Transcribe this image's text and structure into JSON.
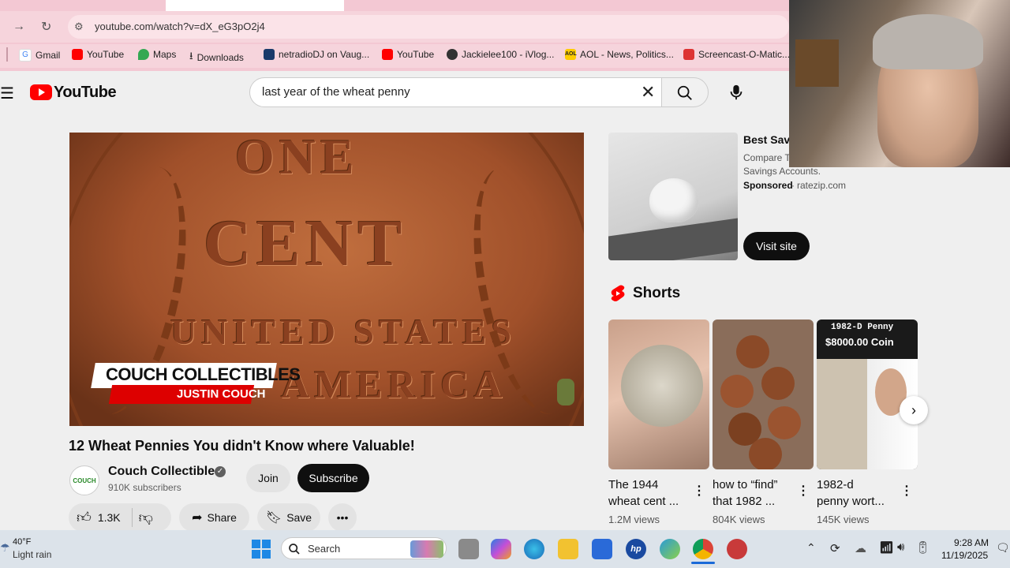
{
  "browser": {
    "url": "youtube.com/watch?v=dX_eG3pO2j4",
    "bookmarks": [
      "Gmail",
      "YouTube",
      "Maps",
      "Downloads",
      "netradioDJ on Vaug...",
      "YouTube",
      "Jackielee100 - iVlog...",
      "AOL - News, Politics...",
      "Screencast-O-Matic..."
    ]
  },
  "youtube": {
    "logo_text": "YouTube",
    "search_query": "last year of the wheat penny",
    "video": {
      "overlay_channel": "COUCH COLLECTIBLES",
      "overlay_name": "JUSTIN COUCH",
      "coin_words": [
        "ONE",
        "CENT",
        "UNITED STATES",
        "AMERICA"
      ],
      "title": "12 Wheat Pennies You didn't Know where Valuable!",
      "channel_name": "Couch Collectibles",
      "avatar_text": "COUCH",
      "subscribers": "910K subscribers",
      "join_label": "Join",
      "subscribe_label": "Subscribe",
      "likes": "1.3K",
      "share_label": "Share",
      "save_label": "Save"
    },
    "ad": {
      "title": "Best Savi",
      "desc_line1": "Compare T",
      "desc_line2": "Savings Accounts.",
      "sponsored": "Sponsored",
      "domain": "ratezip.com",
      "visit_label": "Visit site"
    },
    "shorts_heading": "Shorts",
    "shorts": [
      {
        "title_line1": "The 1944",
        "title_line2": "wheat cent ...",
        "views": "1.2M views"
      },
      {
        "title_line1": "how to “find”",
        "title_line2": "that 1982 ...",
        "views": "804K views"
      },
      {
        "title_line1": "1982-d",
        "title_line2": "penny wort...",
        "views": "145K views",
        "thumb_top": "1982-D Penny",
        "thumb_price": "$8000.00 Coin"
      }
    ]
  },
  "taskbar": {
    "weather_temp": "40°F",
    "weather_desc": "Light rain",
    "search_label": "Search",
    "time": "9:28 AM",
    "date": "11/19/2025"
  },
  "colors": {
    "youtube_red": "#ff0000",
    "chrome_pink": "#f3c8d3",
    "taskbar": "#dce3ea"
  }
}
